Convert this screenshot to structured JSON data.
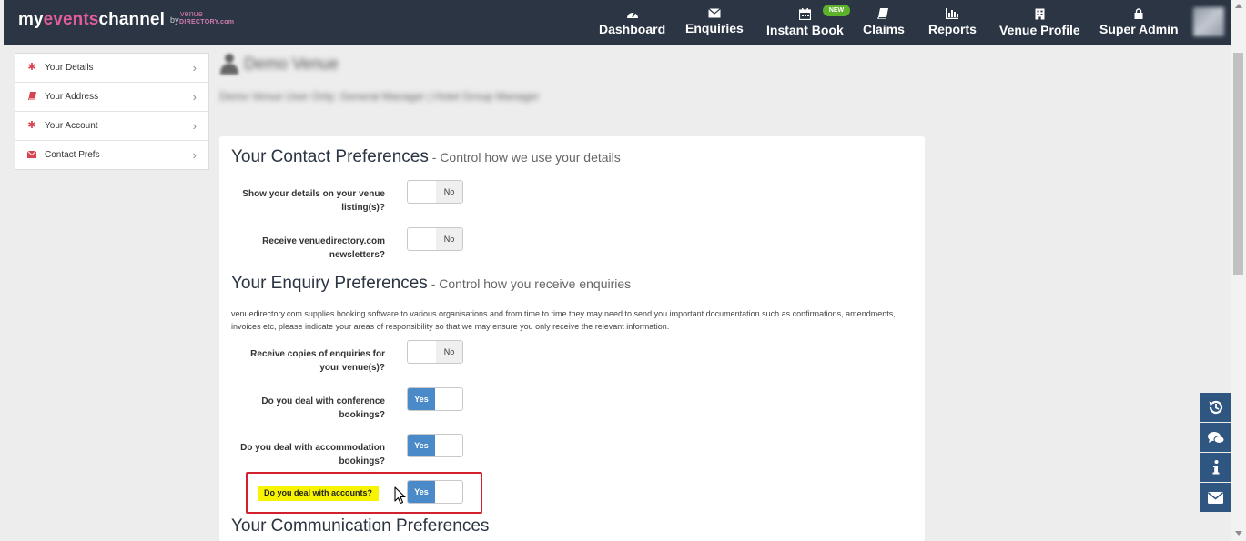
{
  "brand": {
    "part1": "my",
    "part2": "events",
    "part3": "channel",
    "by": "by",
    "venue": "venue",
    "directory": "DIRECTORY.com"
  },
  "nav": {
    "items": [
      {
        "label": "Dashboard",
        "icon": "dashboard-icon"
      },
      {
        "label": "Enquiries",
        "icon": "envelope-icon"
      },
      {
        "label": "Instant Book",
        "icon": "calendar-icon"
      },
      {
        "label": "Claims",
        "icon": "book-icon"
      },
      {
        "label": "Reports",
        "icon": "bar-chart-icon"
      },
      {
        "label": "Venue Profile",
        "icon": "building-icon"
      },
      {
        "label": "Super Admin",
        "icon": "lock-icon"
      }
    ],
    "new_badge": "NEW"
  },
  "sidebar": {
    "items": [
      {
        "label": "Your Details"
      },
      {
        "label": "Your Address"
      },
      {
        "label": "Your Account"
      },
      {
        "label": "Contact Prefs"
      }
    ]
  },
  "profile": {
    "name": "Demo Venue",
    "subtitle": "Demo Venue User Only: General Manager | Hotel Group Manager"
  },
  "sections": {
    "contact": {
      "title": "Your Contact Preferences",
      "subtitle": " - Control how we use your details"
    },
    "enquiry": {
      "title": "Your Enquiry Preferences",
      "subtitle": " - Control how you receive enquiries",
      "description": "venuedirectory.com supplies booking software to various organisations and from time to time they may need to send you important documentation such as confirmations, amendments, invoices etc, please indicate your areas of responsibility so that we may ensure you only receive the relevant information."
    },
    "communication": {
      "title": "Your Communication Preferences"
    }
  },
  "preferences": [
    {
      "label": "Show your details on your venue listing(s)?",
      "value": "No"
    },
    {
      "label": "Receive venuedirectory.com newsletters?",
      "value": "No"
    },
    {
      "label": "Receive copies of enquiries for your venue(s)?",
      "value": "No"
    },
    {
      "label": "Do you deal with conference bookings?",
      "value": "Yes"
    },
    {
      "label": "Do you deal with accommodation bookings?",
      "value": "Yes"
    },
    {
      "label": "Do you deal with accounts?",
      "value": "Yes"
    }
  ],
  "colors": {
    "topbar": "#2b3544",
    "accent_pink": "#e25e9a",
    "toggle_on": "#4a8ac8",
    "highlight": "#f8f400",
    "highlight_border": "#d2202f",
    "tool_buttons": "#2f5680"
  },
  "tools": [
    "history-icon",
    "comments-icon",
    "info-icon",
    "envelope-icon"
  ]
}
